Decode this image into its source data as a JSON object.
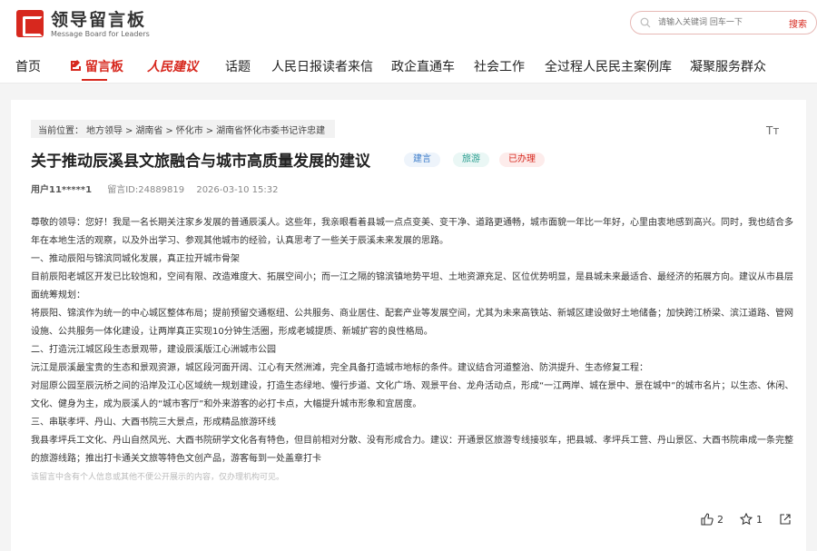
{
  "header": {
    "logo_cn": "领导留言板",
    "logo_en": "Message Board for Leaders",
    "search_placeholder": "请输入关键词 回车一下",
    "search_button": "搜索",
    "nav": [
      {
        "label": "首页"
      },
      {
        "label": "留言板"
      },
      {
        "label": "人民建议"
      },
      {
        "label": "话题"
      },
      {
        "label": "人民日报读者来信"
      },
      {
        "label": "政企直通车"
      },
      {
        "label": "社会工作"
      },
      {
        "label": "全过程人民民主案例库"
      },
      {
        "label": "凝聚服务群众"
      }
    ]
  },
  "breadcrumb": {
    "prefix": "当前位置：",
    "items": [
      "地方领导",
      ">",
      "湖南省",
      ">",
      "怀化市",
      ">",
      "湖南省怀化市委书记许忠建"
    ]
  },
  "font_size_icon": "Tт",
  "post": {
    "title": "关于推动辰溪县文旅融合与城市高质量发展的建议",
    "tags": [
      {
        "label": "建言",
        "color": "#3d7dca",
        "bg": "#eef4fb"
      },
      {
        "label": "旅游",
        "color": "#2a9d8f",
        "bg": "#eaf7f5"
      },
      {
        "label": "已办理",
        "color": "#d7281e",
        "bg": "#fdeceb"
      }
    ],
    "user": "用户11*****1",
    "message_id": "留言ID:24889819",
    "datetime": "2026-03-10 15:32",
    "paragraphs": [
      "尊敬的领导：您好！我是一名长期关注家乡发展的普通辰溪人。这些年，我亲眼看着县城一点点变美、变干净、道路更通畅，城市面貌一年比一年好，心里由衷地感到高兴。同时，我也结合多年在本地生活的观察，以及外出学习、参观其他城市的经验，认真思考了一些关于辰溪未来发展的思路。",
      "一、推动辰阳与锦滨同城化发展，真正拉开城市骨架",
      "目前辰阳老城区开发已比较饱和，空间有限、改造难度大、拓展空间小；而一江之隔的锦滨镇地势平坦、土地资源充足、区位优势明显，是县城未来最适合、最经济的拓展方向。建议从市县层面统筹规划：",
      "将辰阳、锦滨作为统一的中心城区整体布局；提前预留交通枢纽、公共服务、商业居住、配套产业等发展空间，尤其为未来高铁站、新城区建设做好土地储备；加快跨江桥梁、滨江道路、管网设施、公共服务一体化建设，让两岸真正实现10分钟生活圈，形成老城提质、新城扩容的良性格局。",
      "二、打造沅江城区段生态景观带，建设辰溪版江心洲城市公园",
      "沅江是辰溪最宝贵的生态和景观资源，城区段河面开阔、江心有天然洲滩，完全具备打造城市地标的条件。建议结合河道整治、防洪提升、生态修复工程：",
      "对屈原公园至辰沅桥之间的沿岸及江心区域统一规划建设，打造生态绿地、慢行步道、文化广场、观景平台、龙舟活动点，形成“一江两岸、城在景中、景在城中”的城市名片；以生态、休闲、文化、健身为主，成为辰溪人的“城市客厅”和外来游客的必打卡点，大幅提升城市形象和宜居度。",
      "三、串联孝坪、丹山、大酉书院三大景点，形成精品旅游环线",
      "我县孝坪兵工文化、丹山自然风光、大酉书院研学文化各有特色，但目前相对分散、没有形成合力。建议：开通景区旅游专线接驳车，把县城、孝坪兵工营、丹山景区、大酉书院串成一条完整的旅游线路；推出打卡通关文旅等特色文创产品，游客每到一处盖章打卡"
    ],
    "privacy_note": "该留言中含有个人信息或其他不便公开展示的内容，仅办理机构可见。",
    "likes": "2",
    "favorites": "1"
  },
  "colors": {
    "brand": "#d7281e"
  }
}
